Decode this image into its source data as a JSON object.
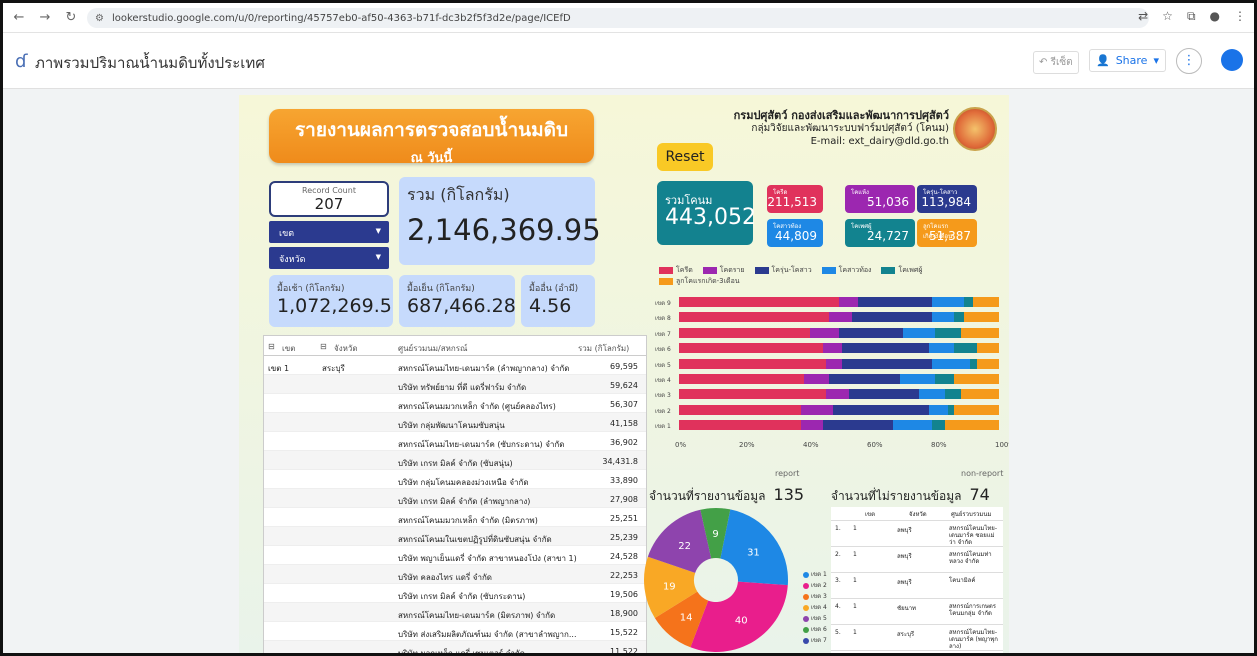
{
  "browser": {
    "url": "lookerstudio.google.com/u/0/reporting/45757eb0-af50-4363-b71f-dc3b2f5f3d2e/page/ICEfD"
  },
  "app": {
    "title": "ภาพรวมปริมาณน้ำนมดิบทั้งประเทศ",
    "undo_label": "รีเซ็ต",
    "share_label": "Share"
  },
  "report": {
    "banner_line1": "รายงานผลการตรวจสอบน้ำนมดิบ",
    "banner_line2": "ณ วันนี้",
    "dept_line1": "กรมปศุสัตว์ กองส่งเสริมและพัฒนาการปศุสัตว์",
    "dept_line2": "กลุ่มวิจัยและพัฒนาระบบฟาร์มปศุสัตว์ (โคนม)",
    "dept_line3": "E-mail: ext_dairy@dld.go.th",
    "reset_label": "Reset",
    "record_count_label": "Record Count",
    "record_count": "207",
    "zone_dropdown": "เขต",
    "province_dropdown": "จังหวัด",
    "total_label": "รวม (กิโลกรัม)",
    "total_value": "2,146,369.95",
    "morning_label": "มื้อเช้า (กิโลกรัม)",
    "morning_value": "1,072,269.5",
    "evening_label": "มื้อเย็น (กิโลกรัม)",
    "evening_value": "687,466.28",
    "other_label": "มื้ออื่น (อำมี)",
    "other_value": "4.56",
    "cattle_total_label": "รวมโคนม",
    "cattle_total": "443,052",
    "kpis": [
      {
        "label": "โครีด",
        "value": "211,513",
        "color": "#e0325c"
      },
      {
        "label": "โคแห้ง",
        "value": "51,036",
        "color": "#9c27b0"
      },
      {
        "label": "โครุ่น-โคสาว",
        "value": "113,984",
        "color": "#2b3a8f"
      },
      {
        "label": "โคสาวท้อง",
        "value": "44,809",
        "color": "#1e88e5"
      },
      {
        "label": "โคเพศผู้",
        "value": "24,727",
        "color": "#12838f"
      },
      {
        "label": "ลูกโคแรกเกิด-3เดือน",
        "value": "51,387",
        "color": "#f59a1b"
      }
    ]
  },
  "left_table": {
    "headers": [
      "เขต",
      "จังหวัด",
      "ศูนย์รวมนม/สหกรณ์",
      "รวม (กิโลกรัม)"
    ],
    "zone": "เขต 1",
    "province": "สระบุรี",
    "rows": [
      {
        "name": "สหกรณ์โคนมไทย-เดนมาร์ค (ลำพญากลาง) จำกัด",
        "value": "69,595"
      },
      {
        "name": "บริษัท ทรัพย์ยาม ที่ดี แดรี่ฟาร์ม จำกัด",
        "value": "59,624"
      },
      {
        "name": "สหกรณ์โคนมมวกเหล็ก จำกัด (ศูนย์คลองไทร)",
        "value": "56,307"
      },
      {
        "name": "บริษัท กลุ่มพัฒนาโคนมซับสนุ่น",
        "value": "41,158"
      },
      {
        "name": "สหกรณ์โคนมไทย-เดนมาร์ค (ซับกระดาน) จำกัด",
        "value": "36,902"
      },
      {
        "name": "บริษัท เกรท มิลค์ จำกัด (ซับสนุ่น)",
        "value": "34,431.8"
      },
      {
        "name": "บริษัท กลุ่มโคนมคลองม่วงเหนือ จำกัด",
        "value": "33,890"
      },
      {
        "name": "บริษัท เกรท มิลค์ จำกัด (ลำพญากลาง)",
        "value": "27,908"
      },
      {
        "name": "สหกรณ์โคนมมวกเหล็ก จำกัด (มิตรภาพ)",
        "value": "25,251"
      },
      {
        "name": "สหกรณ์โคนมในเขตปฏิรูปที่ดินซับสนุ่น จำกัด",
        "value": "25,239"
      },
      {
        "name": "บริษัท พญาเย็นแดรี่ จำกัด สาขาหนองโป่ง (สาขา 1)",
        "value": "24,528"
      },
      {
        "name": "บริษัท คลองไทร แดรี่ จำกัด",
        "value": "22,253"
      },
      {
        "name": "บริษัท เกรท มิลค์ จำกัด (ซับกระดาน)",
        "value": "19,506"
      },
      {
        "name": "สหกรณ์โคนมไทย-เดนมาร์ค (มิตรภาพ) จำกัด",
        "value": "18,900"
      },
      {
        "name": "บริษัท ส่งเสริมผลิตภัณฑ์นม จำกัด (สาขาลำพญาก...",
        "value": "15,522"
      },
      {
        "name": "บริษัท มวกเหล็ก แดรี่ เซนเตอร์ จำกัด",
        "value": "11,522"
      }
    ]
  },
  "chart_data": [
    {
      "type": "bar",
      "orientation": "horizontal-stacked-100",
      "categories": [
        "เขต 9",
        "เขต 8",
        "เขต 7",
        "เขต 6",
        "เขต 5",
        "เขต 4",
        "เขต 3",
        "เขต 2",
        "เขต 1"
      ],
      "series": [
        {
          "name": "โครีด",
          "color": "#e0325c",
          "values": [
            50,
            47,
            41,
            45,
            46,
            39,
            46,
            38,
            38
          ]
        },
        {
          "name": "โคดราย",
          "color": "#9c27b0",
          "values": [
            6,
            7,
            9,
            6,
            5,
            8,
            7,
            10,
            7
          ]
        },
        {
          "name": "โครุ่น-โคสาว",
          "color": "#2b3a8f",
          "values": [
            23,
            25,
            20,
            27,
            28,
            22,
            22,
            30,
            22
          ]
        },
        {
          "name": "โคสาวท้อง",
          "color": "#1e88e5",
          "values": [
            10,
            7,
            10,
            8,
            12,
            11,
            8,
            6,
            12
          ]
        },
        {
          "name": "โคเพศผู้",
          "color": "#12838f",
          "values": [
            3,
            3,
            8,
            7,
            2,
            6,
            5,
            2,
            4
          ]
        },
        {
          "name": "ลูกโคแรกเกิด-3เดือน",
          "color": "#f59a1b",
          "values": [
            8,
            11,
            12,
            7,
            7,
            14,
            12,
            14,
            17
          ]
        }
      ],
      "xticks": [
        "0%",
        "20%",
        "40%",
        "60%",
        "80%",
        "100%"
      ]
    },
    {
      "type": "pie",
      "title": "จำนวนที่รายงานข้อมูล",
      "slices": [
        {
          "label": "เขต 1",
          "value": 31,
          "color": "#1e88e5"
        },
        {
          "label": "เขต 2",
          "value": 40,
          "color": "#e91e8c"
        },
        {
          "label": "เขต 3",
          "value": 14,
          "color": "#f5731b"
        },
        {
          "label": "เขต 4",
          "value": 19,
          "color": "#f9a825"
        },
        {
          "label": "เขต 5",
          "value": 22,
          "color": "#8e44ad"
        },
        {
          "label": "เขต 6",
          "value": 9,
          "color": "#43a047"
        }
      ]
    }
  ],
  "lower": {
    "report_tag": "report",
    "report_label": "จำนวนที่รายงานข้อมูล",
    "report_count": "135",
    "nonreport_tag": "non-report",
    "nonreport_label": "จำนวนที่ไม่รายงานข้อมูล",
    "nonreport_count": "74",
    "pie_legend": [
      "เขต 1",
      "เขต 2",
      "เขต 3",
      "เขต 4",
      "เขต 5",
      "เขต 6",
      "เขต 7"
    ],
    "nr_headers": [
      "เขต",
      "จังหวัด",
      "ศูนย์รวบรวมนม"
    ],
    "nr_rows": [
      {
        "n": "1.",
        "z": "1",
        "p": "ลพบุรี",
        "c": "สหกรณ์โคนมไทย-เดนมาร์ค ซอยแม่ว่า จำกัด"
      },
      {
        "n": "2.",
        "z": "1",
        "p": "ลพบุรี",
        "c": "สหกรณ์โคนมท่าหลวง จำกัด"
      },
      {
        "n": "3.",
        "z": "1",
        "p": "ลพบุรี",
        "c": "โคนามิลค์"
      },
      {
        "n": "4.",
        "z": "1",
        "p": "ชัยนาท",
        "c": "สหกรณ์การเกษตรโคนมกลุ่ม จำกัด"
      },
      {
        "n": "5.",
        "z": "1",
        "p": "สระบุรี",
        "c": "สหกรณ์โคนมไทย-เดนมาร์ค (พญาพุกลาง)"
      }
    ]
  }
}
